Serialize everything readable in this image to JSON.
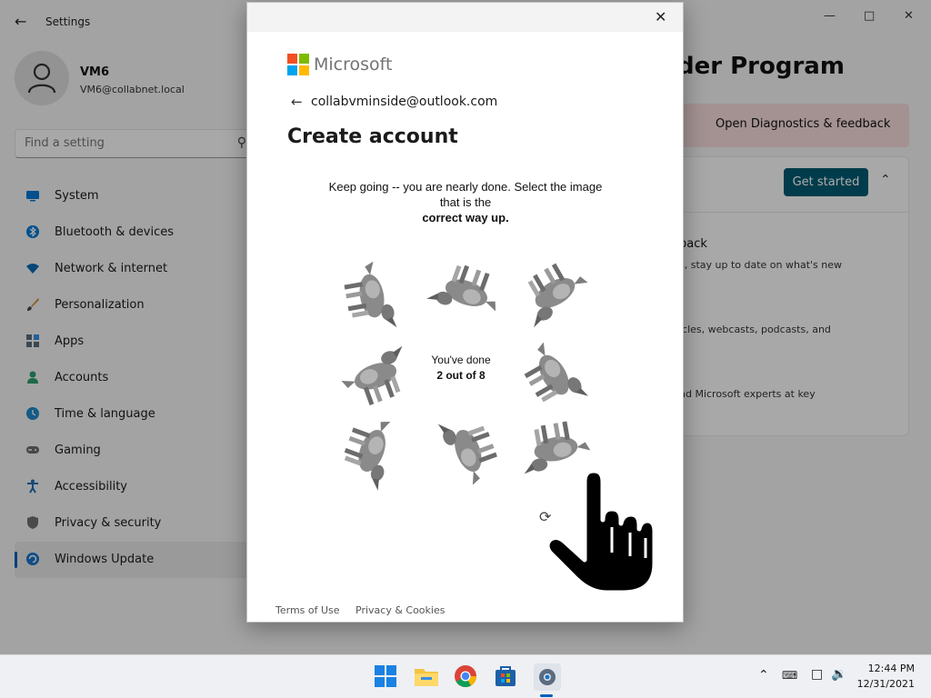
{
  "settings": {
    "app_title": "Settings",
    "profile": {
      "name": "VM6",
      "email": "VM6@collabnet.local"
    },
    "search": {
      "placeholder": "Find a setting"
    },
    "nav": [
      {
        "label": "System",
        "icon": "monitor-icon",
        "color": "#0078d4"
      },
      {
        "label": "Bluetooth & devices",
        "icon": "bluetooth-icon",
        "color": "#0078d4"
      },
      {
        "label": "Network & internet",
        "icon": "wifi-icon",
        "color": "#0a6bb5"
      },
      {
        "label": "Personalization",
        "icon": "brush-icon",
        "color": "#d08a3a"
      },
      {
        "label": "Apps",
        "icon": "apps-icon",
        "color": "#5a6a7a"
      },
      {
        "label": "Accounts",
        "icon": "accounts-icon",
        "color": "#2a9d6e"
      },
      {
        "label": "Time & language",
        "icon": "globe-clock-icon",
        "color": "#1e88c8"
      },
      {
        "label": "Gaming",
        "icon": "gamepad-icon",
        "color": "#6a6a6a"
      },
      {
        "label": "Accessibility",
        "icon": "accessibility-icon",
        "color": "#1f6fb6"
      },
      {
        "label": "Privacy & security",
        "icon": "shield-icon",
        "color": "#6f6f6f"
      },
      {
        "label": "Windows Update",
        "icon": "update-icon",
        "color": "#1a73c8",
        "selected": true
      }
    ],
    "page_heading": "der Program",
    "diagnostics_link": "Open Diagnostics & feedback",
    "get_started": "Get started",
    "panel_items": [
      {
        "title": "back",
        "text": "s, stay up to date on what's new"
      },
      {
        "title": "",
        "text": "icles, webcasts, podcasts, and"
      },
      {
        "title": "",
        "text": "nd Microsoft experts at key"
      }
    ]
  },
  "dialog": {
    "brand": "Microsoft",
    "email": "collabvminside@outlook.com",
    "heading": "Create account",
    "captcha": {
      "instruction_1": "Keep going -- you are nearly done. Select the image that is the",
      "instruction_bold": "correct way up.",
      "progress_line": "You've done",
      "progress_bold": "2 out of 8",
      "progress_done": 2,
      "progress_total": 8
    },
    "footer": {
      "terms": "Terms of Use",
      "privacy": "Privacy & Cookies"
    }
  },
  "taskbar": {
    "apps": [
      "start-icon",
      "file-explorer-icon",
      "chrome-icon",
      "store-icon",
      "settings-icon"
    ],
    "time": "12:44 PM",
    "date": "12/31/2021"
  },
  "colors": {
    "accent": "#005fb8",
    "get_started_bg": "#005a70",
    "diag_bar_bg": "#f5dada",
    "ms_red": "#f25022",
    "ms_green": "#7fba00",
    "ms_blue": "#00a4ef",
    "ms_yellow": "#ffb900"
  }
}
